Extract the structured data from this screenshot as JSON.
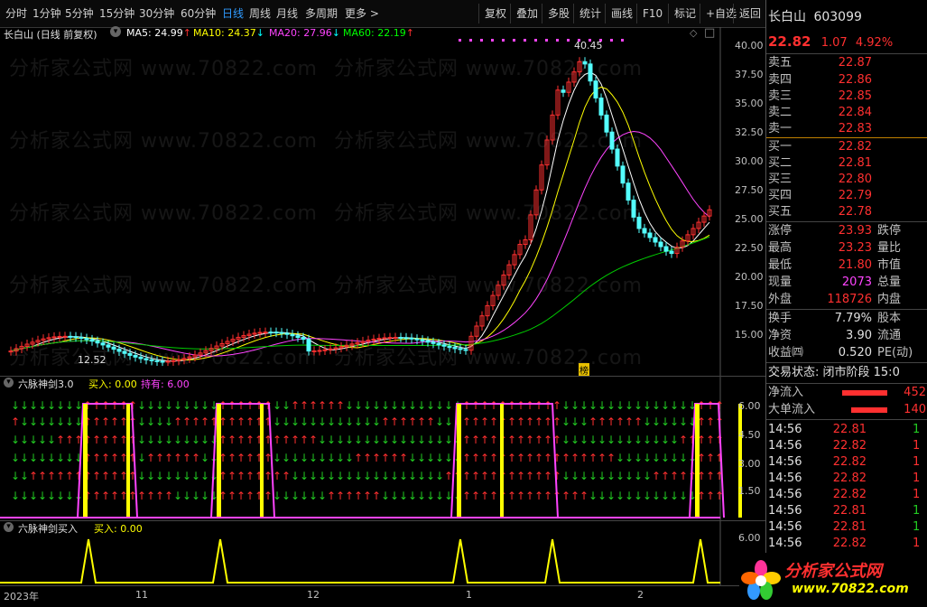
{
  "toolbar": {
    "periods": [
      "分时",
      "1分钟",
      "5分钟",
      "15分钟",
      "30分钟",
      "60分钟",
      "日线",
      "周线",
      "月线",
      "多周期",
      "更多 >"
    ],
    "active_period": "日线",
    "tools": [
      "复权",
      "叠加",
      "多股",
      "统计",
      "画线",
      "F10",
      "标记",
      "+自选",
      "返回"
    ]
  },
  "main": {
    "title": "长白山 (日线 前复权)",
    "ma": [
      {
        "label": "MA5: 24.99",
        "arrow": "↑",
        "color": "#ffffff"
      },
      {
        "label": "MA10: 24.37",
        "arrow": "↓",
        "color": "#ffff00"
      },
      {
        "label": "MA20: 27.96",
        "arrow": "↓",
        "color": "#ff44ff"
      },
      {
        "label": "MA60: 22.19",
        "arrow": "↑",
        "color": "#00ff00"
      }
    ],
    "y_ticks": [
      "40.00",
      "37.50",
      "35.00",
      "32.50",
      "30.00",
      "27.50",
      "25.00",
      "22.50",
      "20.00",
      "17.50",
      "15.00"
    ],
    "high_label": "40.45",
    "low_label": "12.52",
    "bang": "榜"
  },
  "indicator1": {
    "title": "六脉神剑3.0",
    "buy_label": "买入: 0.00",
    "hold_label": "持有: 6.00",
    "y_ticks": [
      "6.00",
      "4.50",
      "3.00",
      "1.50"
    ]
  },
  "indicator2": {
    "title": "六脉神剑买入",
    "buy_label": "买入: 0.00",
    "y_ticks": [
      "6.00",
      "0.00"
    ]
  },
  "xaxis": {
    "labels": [
      "2023年",
      "11",
      "12",
      "1",
      "2"
    ]
  },
  "watermark": "分析家公式网 www.70822.com",
  "stock": {
    "name": "长白山",
    "code": "603099",
    "price": "22.82",
    "change": "1.07",
    "change_pct": "4.92%"
  },
  "asks": [
    {
      "label": "卖五",
      "price": "22.87"
    },
    {
      "label": "卖四",
      "price": "22.86"
    },
    {
      "label": "卖三",
      "price": "22.85"
    },
    {
      "label": "卖二",
      "price": "22.84"
    },
    {
      "label": "卖一",
      "price": "22.83"
    }
  ],
  "bids": [
    {
      "label": "买一",
      "price": "22.82"
    },
    {
      "label": "买二",
      "price": "22.81"
    },
    {
      "label": "买三",
      "price": "22.80"
    },
    {
      "label": "买四",
      "price": "22.79"
    },
    {
      "label": "买五",
      "price": "22.78"
    }
  ],
  "stats": [
    {
      "label": "涨停",
      "value": "23.93",
      "right": "跌停"
    },
    {
      "label": "最高",
      "value": "23.23",
      "right": "量比"
    },
    {
      "label": "最低",
      "value": "21.80",
      "right": "市值"
    },
    {
      "label": "现量",
      "value": "2073",
      "right": "总量"
    },
    {
      "label": "外盘",
      "value": "118726",
      "right": "内盘"
    }
  ],
  "stats2": [
    {
      "label": "换手",
      "value": "7.79%",
      "right": "股本"
    },
    {
      "label": "净资",
      "value": "3.90",
      "right": "流通"
    },
    {
      "label": "收益㈣",
      "value": "0.520",
      "right": "PE(动)"
    }
  ],
  "trade_state": "交易状态: 闭市阶段 15:0",
  "flows": [
    {
      "label": "净流入",
      "value": "452"
    },
    {
      "label": "大单流入",
      "value": "140"
    }
  ],
  "ticks": [
    {
      "time": "14:56",
      "price": "22.81",
      "color": "#ff3030"
    },
    {
      "time": "14:56",
      "price": "22.82",
      "color": "#ff3030"
    },
    {
      "time": "14:56",
      "price": "22.82",
      "color": "#ff3030"
    },
    {
      "time": "14:56",
      "price": "22.82",
      "color": "#ff3030"
    },
    {
      "time": "14:56",
      "price": "22.82",
      "color": "#ff3030"
    },
    {
      "time": "14:56",
      "price": "22.81",
      "color": "#ff3030"
    },
    {
      "time": "14:56",
      "price": "22.81",
      "color": "#ff3030"
    },
    {
      "time": "14:56",
      "price": "22.82",
      "color": "#ff3030"
    }
  ],
  "logo": {
    "title": "分析家公式网",
    "url": "www.70822.com"
  },
  "colors": {
    "up": "#ff3030",
    "down": "#22cc22",
    "accent": "#2f9bff"
  }
}
